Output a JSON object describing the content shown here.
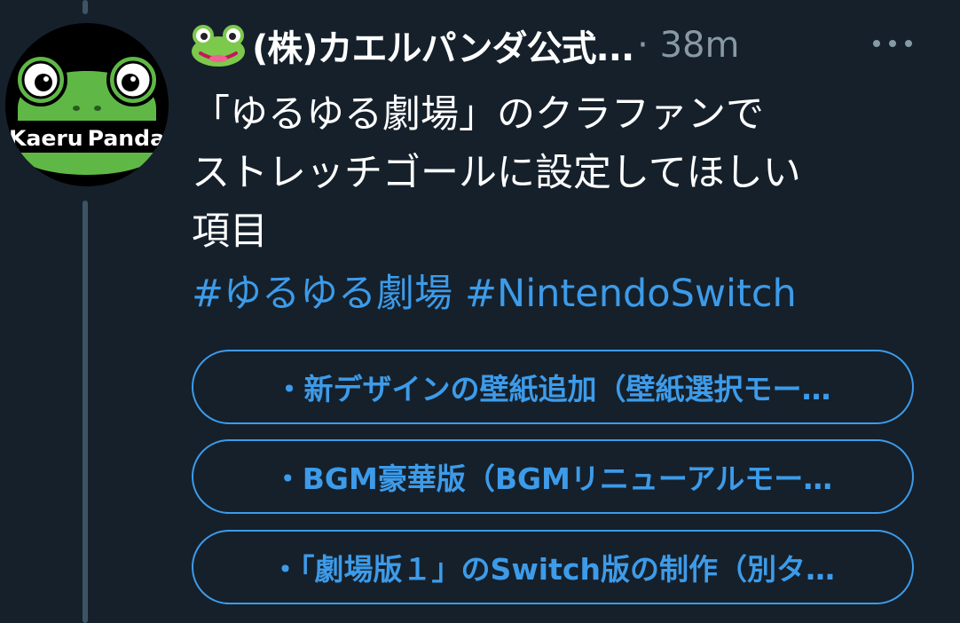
{
  "tweet": {
    "avatar_text": "Kaeru Panda",
    "author_emoji_icon": "frog-face-icon",
    "author_name": "(株)カエルパンダ公式...",
    "meta": "· 38m",
    "more_icon": "more-horizontal-icon",
    "body_lines": [
      "「ゆるゆる劇場」のクラファンで",
      "ストレッチゴールに設定してほしい",
      "項目"
    ],
    "hashtags": [
      "#ゆるゆる劇場",
      "#NintendoSwitch"
    ]
  },
  "poll": {
    "options": [
      {
        "label": "・新デザインの壁紙追加（壁紙選択モー…"
      },
      {
        "label": "・BGM豪華版（BGMリニューアルモー…"
      },
      {
        "label": "・「劇場版１」のSwitch版の制作（別タ…"
      }
    ]
  },
  "colors": {
    "background": "#15202b",
    "text": "#ffffff",
    "secondary": "#8899a6",
    "accent": "#3d9be9",
    "thread_line": "#3d5466",
    "frog_green": "#5fb845"
  }
}
